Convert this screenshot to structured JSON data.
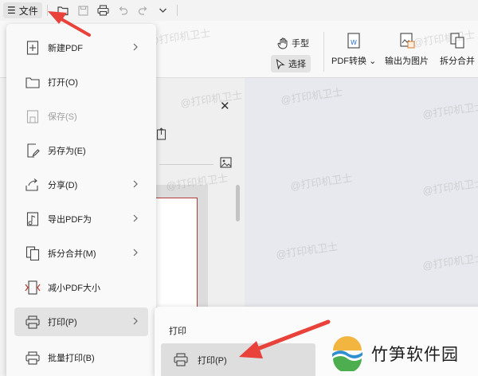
{
  "titlebar": {
    "file_label": "文件",
    "quick_access_icons": [
      "folder-open-icon",
      "save-icon",
      "print-icon",
      "undo-icon",
      "redo-icon",
      "chevron-down-icon"
    ]
  },
  "ribbon": {
    "hand_tool": "手型",
    "select_tool": "选择",
    "pdf_convert": "PDF转换",
    "export_image": "输出为图片",
    "split_merge": "拆分合并"
  },
  "file_menu": {
    "items": [
      {
        "label": "新建PDF",
        "icon": "new-pdf-icon",
        "has_submenu": true
      },
      {
        "label": "打开(O)",
        "icon": "folder-icon",
        "has_submenu": false
      },
      {
        "label": "保存(S)",
        "icon": "save-icon",
        "has_submenu": false,
        "disabled": true
      },
      {
        "label": "另存为(E)",
        "icon": "save-as-icon",
        "has_submenu": false
      },
      {
        "label": "分享(D)",
        "icon": "share-icon",
        "has_submenu": true
      },
      {
        "label": "导出PDF为",
        "icon": "export-pdf-icon",
        "has_submenu": true
      },
      {
        "label": "拆分合并(M)",
        "icon": "split-merge-icon",
        "has_submenu": true
      },
      {
        "label": "减小PDF大小",
        "icon": "compress-icon",
        "has_submenu": false
      },
      {
        "label": "打印(P)",
        "icon": "print-icon",
        "has_submenu": true,
        "hover": true
      },
      {
        "label": "批量打印(B)",
        "icon": "batch-print-icon",
        "has_submenu": false
      }
    ]
  },
  "print_submenu": {
    "title": "打印",
    "items": [
      {
        "label": "打印(P)",
        "icon": "print-icon"
      }
    ]
  },
  "watermark": "@打印机卫士",
  "logo": {
    "text": "竹笋软件园"
  },
  "colors": {
    "arrow": "#e8423b",
    "thumb_border": "#b3393b",
    "hover": "#e3e3e3"
  }
}
